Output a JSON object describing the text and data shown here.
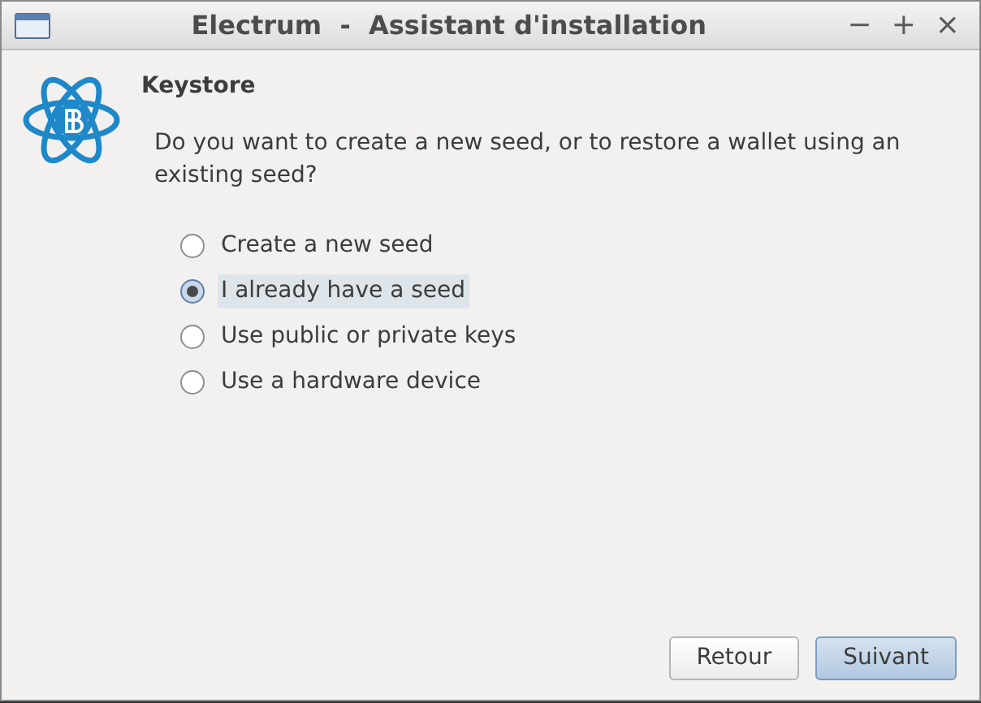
{
  "window": {
    "title": "Electrum  -  Assistant d'installation",
    "controls": [
      "−",
      "+",
      "×"
    ]
  },
  "heading": "Keystore",
  "question": "Do you want to create a new seed, or to restore a wallet using an existing seed?",
  "options": [
    {
      "label": "Create a new seed",
      "selected": false
    },
    {
      "label": "I already have a seed",
      "selected": true
    },
    {
      "label": "Use public or private keys",
      "selected": false
    },
    {
      "label": "Use a hardware device",
      "selected": false
    }
  ],
  "buttons": [
    {
      "label": "Retour",
      "kind": "normal"
    },
    {
      "label": "Suivant",
      "kind": "default"
    }
  ]
}
